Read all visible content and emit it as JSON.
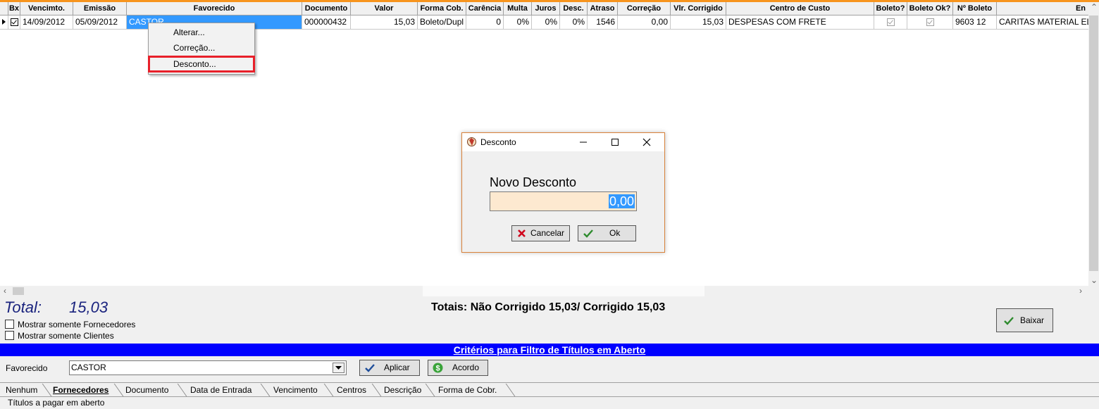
{
  "grid": {
    "headers": [
      "Bx",
      "Vencimto.",
      "Emissão",
      "Favorecido",
      "Documento",
      "Valor",
      "Forma Cob.",
      "Carência",
      "Multa",
      "Juros",
      "Desc.",
      "Atraso",
      "Correção",
      "Vlr. Corrigido",
      "Centro de Custo",
      "Boleto?",
      "Boleto Ok?",
      "Nº Boleto",
      "En"
    ],
    "row": {
      "bx_checked": true,
      "vencimento": "14/09/2012",
      "emissao": "05/09/2012",
      "favorecido": "CASTOR",
      "documento": "000000432",
      "valor": "15,03",
      "forma_cob": "Boleto/Dupl",
      "carencia": "0",
      "multa": "0%",
      "juros": "0%",
      "desc": "0%",
      "atraso": "1546",
      "correcao": "0,00",
      "vlr_corrigido": "15,03",
      "centro_custo": "DESPESAS COM FRETE",
      "boleto": true,
      "boleto_ok": true,
      "n_boleto": "9603 12",
      "en": "CARITAS MATERIAL EL"
    }
  },
  "context_menu": {
    "items": [
      "Alterar...",
      "Correção...",
      "Desconto..."
    ],
    "highlighted": "Desconto..."
  },
  "dialog": {
    "title": "Desconto",
    "label": "Novo Desconto",
    "value": "0,00",
    "cancel": "Cancelar",
    "ok": "Ok"
  },
  "totals": {
    "total_label": "Total:",
    "total_value": "15,03",
    "summary": "Totais: Não Corrigido 15,03/ Corrigido 15,03"
  },
  "checkboxes": {
    "fornecedores": "Mostrar somente Fornecedores",
    "clientes": "Mostrar somente Clientes"
  },
  "baixar": "Baixar",
  "filter": {
    "title": "Critérios para Filtro de Títulos em Aberto",
    "favorecido_label": "Favorecido",
    "favorecido_value": "CASTOR",
    "aplicar": "Aplicar",
    "acordo": "Acordo"
  },
  "tabs": [
    "Nenhum",
    "Fornecedores",
    "Documento",
    "Data de Entrada",
    "Vencimento",
    "Centros",
    "Descrição",
    "Forma de Cobr."
  ],
  "active_tab": "Fornecedores",
  "status": "Títulos a pagar em aberto",
  "colors": {
    "accent_orange": "#f7941d",
    "filter_bar": "#0000ff",
    "selection": "#3399ff",
    "total_text": "#1a237e",
    "highlight_box": "#e8202a"
  }
}
